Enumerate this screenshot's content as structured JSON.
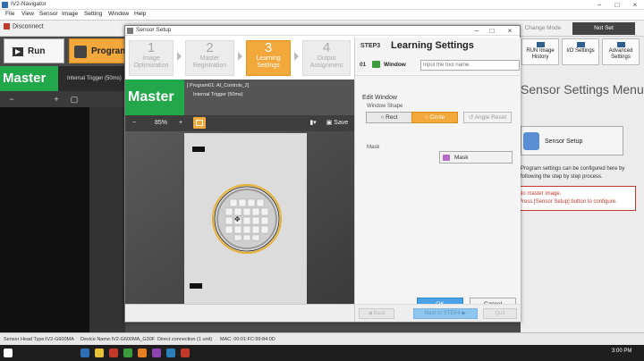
{
  "app": {
    "title": "IV2-Navigator",
    "menu": [
      "File",
      "View",
      "Sensor",
      "Image",
      "Setting",
      "Window",
      "Help"
    ],
    "disconnect_label": "Disconnect",
    "run_label": "Run",
    "program_label": "Program",
    "master_label": "Master",
    "trigger_label": "Internal Trigger (50ms)",
    "change_mode_label": "Change Mode",
    "not_set_label": "Not Set",
    "right_tools": [
      {
        "label": "RUN Image History"
      },
      {
        "label": "I/O Settings"
      },
      {
        "label": "Advanced Settings"
      }
    ],
    "settings_menu_title": "Sensor Settings Menu",
    "sensor_setup_label": "Sensor Setup",
    "setup_desc": "Program settings can be configured here by following the step by step process.",
    "warn_line1": "No master image.",
    "warn_line2": "Press [Sensor Setup] button to configure."
  },
  "statusbar": {
    "sensor_head": "Sensor Head Type:IV2-G600MA",
    "device_name": "Device Name:IV2-G600MA_G30F",
    "connection": "Direct connection (1 unit)",
    "mac": "MAC: 00:01:FC:99:84:0D"
  },
  "taskbar": {
    "clock": "3:00 PM"
  },
  "dialog": {
    "title": "Sensor Setup",
    "steps": [
      {
        "num": "1",
        "label": "Image Optimization",
        "state": "inactive"
      },
      {
        "num": "2",
        "label": "Master Registration",
        "state": "inactive"
      },
      {
        "num": "3",
        "label": "Learning Settings",
        "state": "active"
      },
      {
        "num": "4",
        "label": "Output Assignment",
        "state": "inactive"
      }
    ],
    "master_label": "Master",
    "program_info": "[ Program01: AI_Controls_2]",
    "trigger_info": "Internal Trigger (50ms)",
    "zoom": "85%",
    "save_label": "Save",
    "panel": {
      "step_label": "STEP3",
      "title": "Learning Settings",
      "tool_num": "01",
      "tool_name": "Window",
      "tool_placeholder": "Input the tool name.",
      "edit_window_label": "Edit Window",
      "window_shape_label": "Window Shape",
      "rect_label": "Rect",
      "circle_label": "Circle",
      "angle_reset_label": "Angle Reset",
      "mask_label": "Mask",
      "mask_button_label": "Mask",
      "ok_label": "OK",
      "cancel_label": "Cancel",
      "back_label": "Back",
      "next_label": "Next to STEP4",
      "quit_label": "Quit"
    },
    "colors": {
      "accent": "#f3a83b",
      "master_green": "#22a84a",
      "ok_blue": "#4aa3e8"
    }
  }
}
